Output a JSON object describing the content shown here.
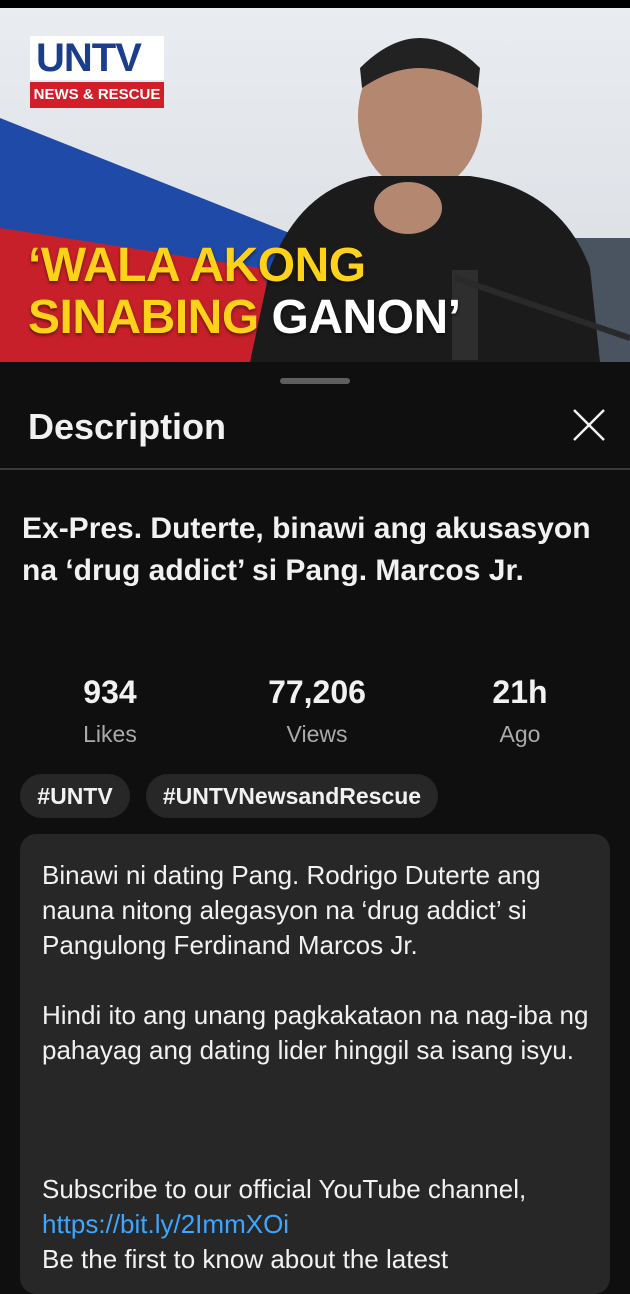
{
  "thumbnail": {
    "logo_word": "UNTV",
    "logo_tag": "NEWS & RESCUE",
    "headline_line1": "‘WALA AKONG",
    "headline_line2_yellow": "SINABING",
    "headline_line2_white": "GANON’"
  },
  "sheet": {
    "title": "Description",
    "close_icon": "close-icon"
  },
  "video": {
    "title": "Ex-Pres. Duterte, binawi ang akusasyon na ‘drug addict’ si Pang. Marcos Jr."
  },
  "stats": [
    {
      "value": "934",
      "label": "Likes"
    },
    {
      "value": "77,206",
      "label": "Views"
    },
    {
      "value": "21h",
      "label": "Ago"
    }
  ],
  "hashtags": [
    "#UNTV",
    "#UNTVNewsandRescue"
  ],
  "description": {
    "para1": "Binawi ni dating Pang. Rodrigo Duterte ang nauna nitong alegasyon na ‘drug addict’ si Pangulong Ferdinand Marcos Jr.",
    "para2": "Hindi ito ang unang pagkakataon na nag-iba ng pahayag ang dating lider hinggil sa isang isyu.",
    "para3": "Subscribe to our official YouTube channel,",
    "link": "https://bit.ly/2ImmXOi",
    "para4": "Be the first to know about the latest"
  },
  "colors": {
    "background": "#0f0f0f",
    "card": "#272727",
    "link": "#3ea6ff",
    "headline_yellow": "#ffd21a",
    "logo_red": "#d11f2a",
    "logo_blue": "#1a3e8c"
  }
}
